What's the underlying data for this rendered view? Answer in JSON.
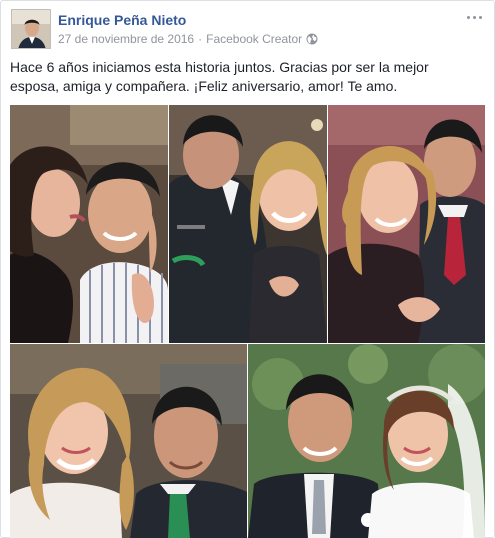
{
  "post": {
    "author": "Enrique Peña Nieto",
    "date": "27 de noviembre de 2016",
    "separator": "·",
    "source": "Facebook Creator",
    "privacy_icon": "globe-icon",
    "more_icon": "more-options-icon",
    "text": "Hace 6 años iniciamos esta historia juntos. Gracias por ser la mejor esposa, amiga y compañera. ¡Feliz aniversario, amor! Te amo."
  },
  "photos": [
    {
      "name": "photo-couple-kiss-cheek"
    },
    {
      "name": "photo-couple-laughing"
    },
    {
      "name": "photo-couple-kiss-temple"
    },
    {
      "name": "photo-couple-smiling"
    },
    {
      "name": "photo-couple-wedding"
    }
  ],
  "colors": {
    "author_link": "#365899",
    "meta_text": "#90949c",
    "body_text": "#1d2129",
    "border": "#dddfe2"
  }
}
